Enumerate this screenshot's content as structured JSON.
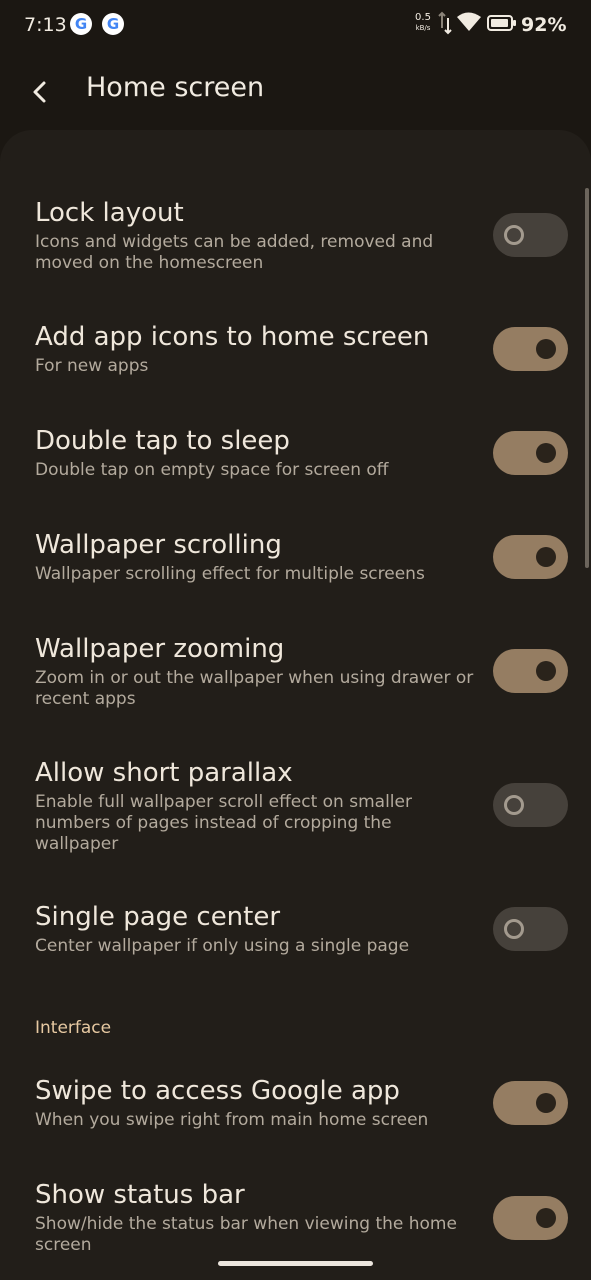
{
  "status_bar": {
    "time": "7:13",
    "net_speed_value": "0.5",
    "net_speed_unit": "kB/s",
    "battery_percent": "92%",
    "icons": [
      "google-icon",
      "google-icon",
      "network-speed-icon",
      "data-transfer-icon",
      "wifi-icon",
      "battery-icon"
    ]
  },
  "header": {
    "title": "Home screen",
    "back_icon": "back-arrow-icon"
  },
  "colors": {
    "background": "#1b1712",
    "sheet": "#221e19",
    "toggle_on": "#957d62",
    "toggle_off": "#46413b",
    "section_header": "#e7c9a2"
  },
  "settings": [
    {
      "title": "Lock layout",
      "subtitle": "Icons and widgets can be added, removed and moved on the homescreen",
      "enabled": false
    },
    {
      "title": "Add app icons to home screen",
      "subtitle": "For new apps",
      "enabled": true
    },
    {
      "title": "Double tap to sleep",
      "subtitle": "Double tap on empty space for screen off",
      "enabled": true
    },
    {
      "title": "Wallpaper scrolling",
      "subtitle": "Wallpaper scrolling effect for multiple screens",
      "enabled": true
    },
    {
      "title": "Wallpaper zooming",
      "subtitle": "Zoom in or out the wallpaper when using drawer or recent apps",
      "enabled": true
    },
    {
      "title": "Allow short parallax",
      "subtitle": "Enable full wallpaper scroll effect on smaller numbers of pages instead of cropping the wallpaper",
      "enabled": false
    },
    {
      "title": "Single page center",
      "subtitle": "Center wallpaper if only using a single page",
      "enabled": false
    }
  ],
  "interface_section": {
    "header": "Interface",
    "settings": [
      {
        "title": "Swipe to access Google app",
        "subtitle": "When you swipe right from main home screen",
        "enabled": true
      },
      {
        "title": "Show status bar",
        "subtitle": "Show/hide the status bar when viewing the home screen",
        "enabled": true
      }
    ]
  }
}
